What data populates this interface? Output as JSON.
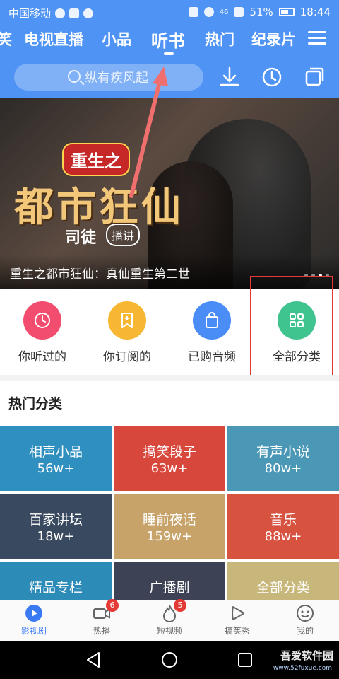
{
  "status_bar": {
    "carrier": "中国移动",
    "signal": "46",
    "battery": "51%",
    "time": "18:44"
  },
  "header": {
    "tabs": [
      {
        "label": "笑",
        "active": false
      },
      {
        "label": "电视直播",
        "active": false
      },
      {
        "label": "小品",
        "active": false
      },
      {
        "label": "听书",
        "active": true
      },
      {
        "label": "热门",
        "active": false
      },
      {
        "label": "纪录片",
        "active": false
      }
    ],
    "search": {
      "placeholder": "纵有疾风起"
    }
  },
  "banner": {
    "tag": "重生之",
    "title_big": "都市狂仙",
    "author": "司徒",
    "role": "播讲",
    "caption": "重生之都市狂仙：真仙重生第二世"
  },
  "quick_actions": [
    {
      "label": "你听过的",
      "icon": "clock-icon",
      "color": "#f24d6e"
    },
    {
      "label": "你订阅的",
      "icon": "bookmark-plus-icon",
      "color": "#f7b733"
    },
    {
      "label": "已购音频",
      "icon": "shopping-bag-icon",
      "color": "#4b8df7"
    },
    {
      "label": "全部分类",
      "icon": "grid-icon",
      "color": "#3fc48f"
    }
  ],
  "section": {
    "title": "热门分类"
  },
  "categories": [
    {
      "name": "相声小品",
      "count": "56w+",
      "color": "#2f8fbf"
    },
    {
      "name": "搞笑段子",
      "count": "63w+",
      "color": "#d8473c"
    },
    {
      "name": "有声小说",
      "count": "80w+",
      "color": "#4a97b6"
    },
    {
      "name": "百家讲坛",
      "count": "18w+",
      "color": "#39495f"
    },
    {
      "name": "睡前夜话",
      "count": "159w+",
      "color": "#c7a36a"
    },
    {
      "name": "音乐",
      "count": "88w+",
      "color": "#d85240"
    },
    {
      "name": "精品专栏",
      "count": "",
      "color": "#2d8bb8"
    },
    {
      "name": "广播剧",
      "count": "",
      "color": "#3d4354"
    },
    {
      "name": "全部分类",
      "count": "",
      "color": "#c8b77a"
    }
  ],
  "bottom_nav": [
    {
      "label": "影视剧",
      "active": true,
      "badge": ""
    },
    {
      "label": "热播",
      "active": false,
      "badge": "6"
    },
    {
      "label": "短视频",
      "active": false,
      "badge": "5"
    },
    {
      "label": "搞笑秀",
      "active": false,
      "badge": ""
    },
    {
      "label": "我的",
      "active": false,
      "badge": ""
    }
  ],
  "watermark": {
    "text": "吾爱软件园",
    "url": "www.52fuxue.com"
  }
}
